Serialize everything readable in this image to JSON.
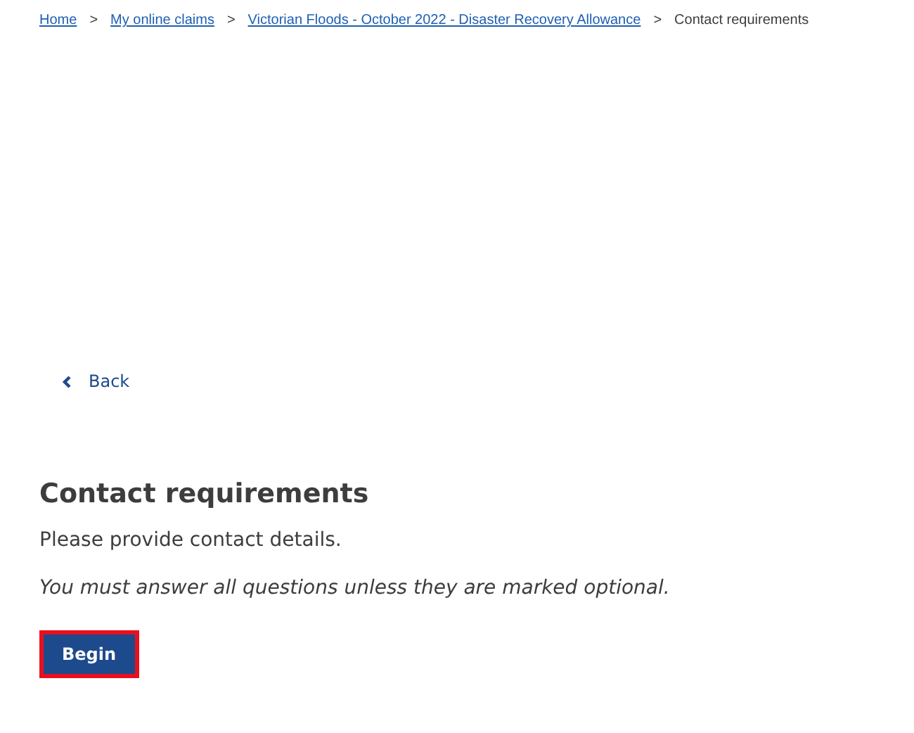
{
  "breadcrumb": [
    {
      "label": "Home",
      "kind": "link"
    },
    {
      "separator": ">",
      "label": "My online claims",
      "kind": "link"
    },
    {
      "separator": ">",
      "label": "Victorian Floods - October 2022 - Disaster Recovery Allowance",
      "kind": "link"
    },
    {
      "separator": ">",
      "label": "Contact requirements",
      "kind": "current"
    }
  ],
  "back_link": {
    "label": "Back"
  },
  "heading": "Contact requirements",
  "intro": "Please provide contact details.",
  "note": "You must answer all questions unless they are marked optional.",
  "begin_button": {
    "label": "Begin",
    "highlighted": true
  }
}
